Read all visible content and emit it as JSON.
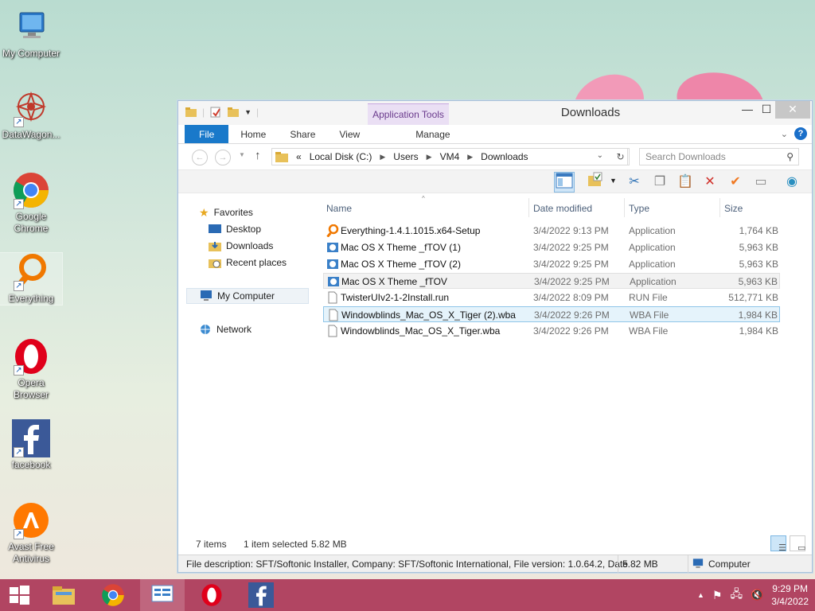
{
  "desktop": {
    "icons": [
      {
        "label": "My Computer",
        "icon": "computer-icon"
      },
      {
        "label": "DataWagon...",
        "icon": "datawagon-icon"
      },
      {
        "label": "Google Chrome",
        "icon": "chrome-icon"
      },
      {
        "label": "Everything",
        "icon": "everything-icon"
      },
      {
        "label": "Opera Browser",
        "icon": "opera-icon"
      },
      {
        "label": "facebook",
        "icon": "facebook-icon"
      },
      {
        "label": "Avast Free Antivirus",
        "icon": "avast-icon"
      }
    ]
  },
  "window": {
    "title": "Downloads",
    "context_tab": "Application Tools",
    "ribbon_tabs": [
      "File",
      "Home",
      "Share",
      "View",
      "Manage"
    ],
    "address": {
      "prefix": "«",
      "segments": [
        "Local Disk (C:)",
        "Users",
        "VM4",
        "Downloads"
      ]
    },
    "search_placeholder": "Search Downloads",
    "nav": {
      "favorites": "Favorites",
      "desktop": "Desktop",
      "downloads": "Downloads",
      "recent": "Recent places",
      "computer": "My Computer",
      "network": "Network"
    },
    "columns": [
      "Name",
      "Date modified",
      "Type",
      "Size"
    ],
    "files": [
      {
        "name": "Everything-1.4.1.1015.x64-Setup",
        "date": "3/4/2022 9:13 PM",
        "type": "Application",
        "size": "1,764 KB",
        "icon": "everything-icon"
      },
      {
        "name": "Mac OS X Theme _fTOV (1)",
        "date": "3/4/2022 9:25 PM",
        "type": "Application",
        "size": "5,963 KB",
        "icon": "installer-icon"
      },
      {
        "name": "Mac OS X Theme _fTOV (2)",
        "date": "3/4/2022 9:25 PM",
        "type": "Application",
        "size": "5,963 KB",
        "icon": "installer-icon"
      },
      {
        "name": "Mac OS X Theme _fTOV",
        "date": "3/4/2022 9:25 PM",
        "type": "Application",
        "size": "5,963 KB",
        "icon": "installer-icon"
      },
      {
        "name": "TwisterUIv2-1-2Install.run",
        "date": "3/4/2022 8:09 PM",
        "type": "RUN File",
        "size": "512,771 KB",
        "icon": "file-icon"
      },
      {
        "name": "Windowblinds_Mac_OS_X_Tiger (2).wba",
        "date": "3/4/2022 9:26 PM",
        "type": "WBA File",
        "size": "1,984 KB",
        "icon": "file-icon"
      },
      {
        "name": "Windowblinds_Mac_OS_X_Tiger.wba",
        "date": "3/4/2022 9:26 PM",
        "type": "WBA File",
        "size": "1,984 KB",
        "icon": "file-icon"
      }
    ],
    "status": {
      "count": "7 items",
      "selected": "1 item selected",
      "size": "5.82 MB"
    },
    "description": {
      "text": "File description: SFT/Softonic Installer, Company: SFT/Softonic International, File version: 1.0.64.2, Date",
      "size": "5.82 MB",
      "location": "Computer"
    }
  },
  "taskbar": {
    "apps": [
      "start-icon",
      "file-explorer-icon",
      "chrome-icon",
      "control-panel-icon",
      "opera-icon",
      "facebook-icon"
    ],
    "clock_time": "9:29 PM",
    "clock_date": "3/4/2022"
  },
  "colors": {
    "file_tab": "#1979ca",
    "context_tab": "#eadff4",
    "taskbar": "#b14562",
    "selection": "#e5f3fb"
  }
}
